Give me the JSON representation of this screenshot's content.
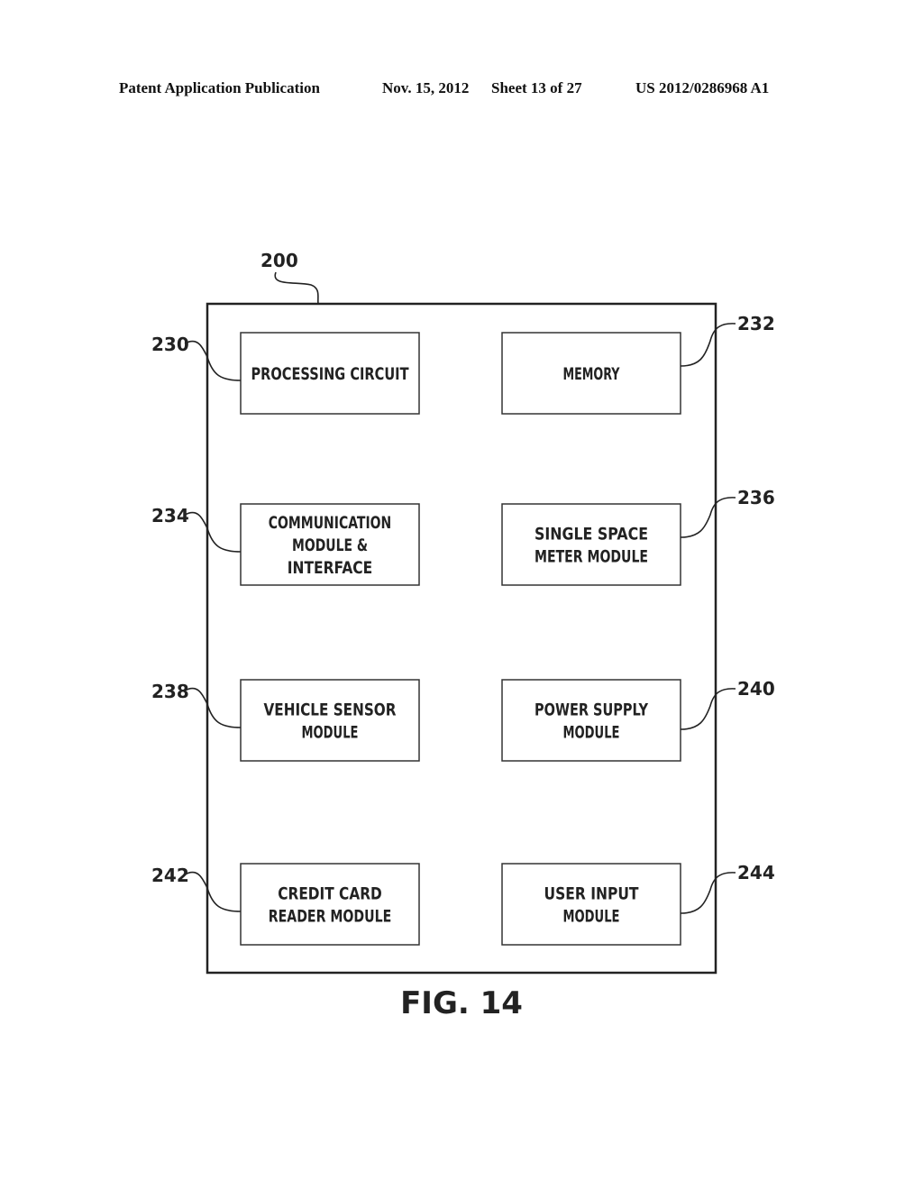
{
  "header": {
    "publication": "Patent Application Publication",
    "date": "Nov. 15, 2012",
    "sheet": "Sheet 13 of 27",
    "number": "US 2012/0286968 A1"
  },
  "diagram": {
    "outer_ref": "200",
    "figure_label": "FIG. 14",
    "boxes": [
      {
        "ref": "230",
        "lines": [
          "PROCESSING CIRCUIT"
        ]
      },
      {
        "ref": "232",
        "lines": [
          "MEMORY"
        ]
      },
      {
        "ref": "234",
        "lines": [
          "COMMUNICATION",
          "MODULE &",
          "INTERFACE"
        ]
      },
      {
        "ref": "236",
        "lines": [
          "SINGLE SPACE",
          "METER MODULE"
        ]
      },
      {
        "ref": "238",
        "lines": [
          "VEHICLE SENSOR",
          "MODULE"
        ]
      },
      {
        "ref": "240",
        "lines": [
          "POWER SUPPLY",
          "MODULE"
        ]
      },
      {
        "ref": "242",
        "lines": [
          "CREDIT CARD",
          "READER MODULE"
        ]
      },
      {
        "ref": "244",
        "lines": [
          "USER INPUT",
          "MODULE"
        ]
      }
    ]
  }
}
